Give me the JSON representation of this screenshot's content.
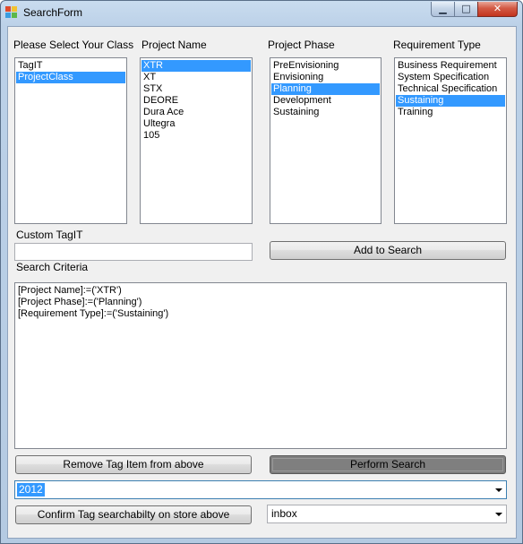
{
  "window": {
    "title": "SearchForm"
  },
  "labels": {
    "class": "Please Select Your Class",
    "project_name": "Project Name",
    "project_phase": "Project Phase",
    "requirement_type": "Requirement Type",
    "custom_tag": "Custom TagIT",
    "search_criteria": "Search Criteria"
  },
  "lists": {
    "class": {
      "items": [
        "TagIT",
        "ProjectClass"
      ],
      "selected": "ProjectClass"
    },
    "project_name": {
      "items": [
        "XTR",
        "XT",
        "STX",
        "DEORE",
        "Dura Ace",
        "Ultegra",
        "105"
      ],
      "selected": "XTR"
    },
    "project_phase": {
      "items": [
        "PreEnvisioning",
        "Envisioning",
        "Planning",
        "Development",
        "Sustaining"
      ],
      "selected": "Planning"
    },
    "requirement_type": {
      "items": [
        "Business Requirement",
        "System Specification",
        "Technical Specification",
        "Sustaining",
        "Training"
      ],
      "selected": "Sustaining"
    }
  },
  "custom_tag": {
    "value": ""
  },
  "search_criteria": {
    "lines": [
      "[Project Name]:=('XTR')",
      "[Project Phase]:=('Planning')",
      "[Requirement Type]:=('Sustaining')"
    ]
  },
  "buttons": {
    "add_to_search": "Add to Search",
    "remove_tag": "Remove Tag Item from above",
    "perform_search": "Perform Search",
    "confirm_tag": "Confirm Tag searchabilty on store above"
  },
  "combos": {
    "year": {
      "value": "2012"
    },
    "store": {
      "value": "inbox"
    }
  },
  "icons": {
    "app": "search-form-app-icon",
    "minimize": "minimize-icon",
    "maximize": "maximize-icon",
    "close": "close-icon",
    "dropdown": "chevron-down-icon"
  },
  "colors": {
    "selection": "#3399ff",
    "title_gradient": "#c9dcef",
    "close_button": "#c2341e"
  }
}
